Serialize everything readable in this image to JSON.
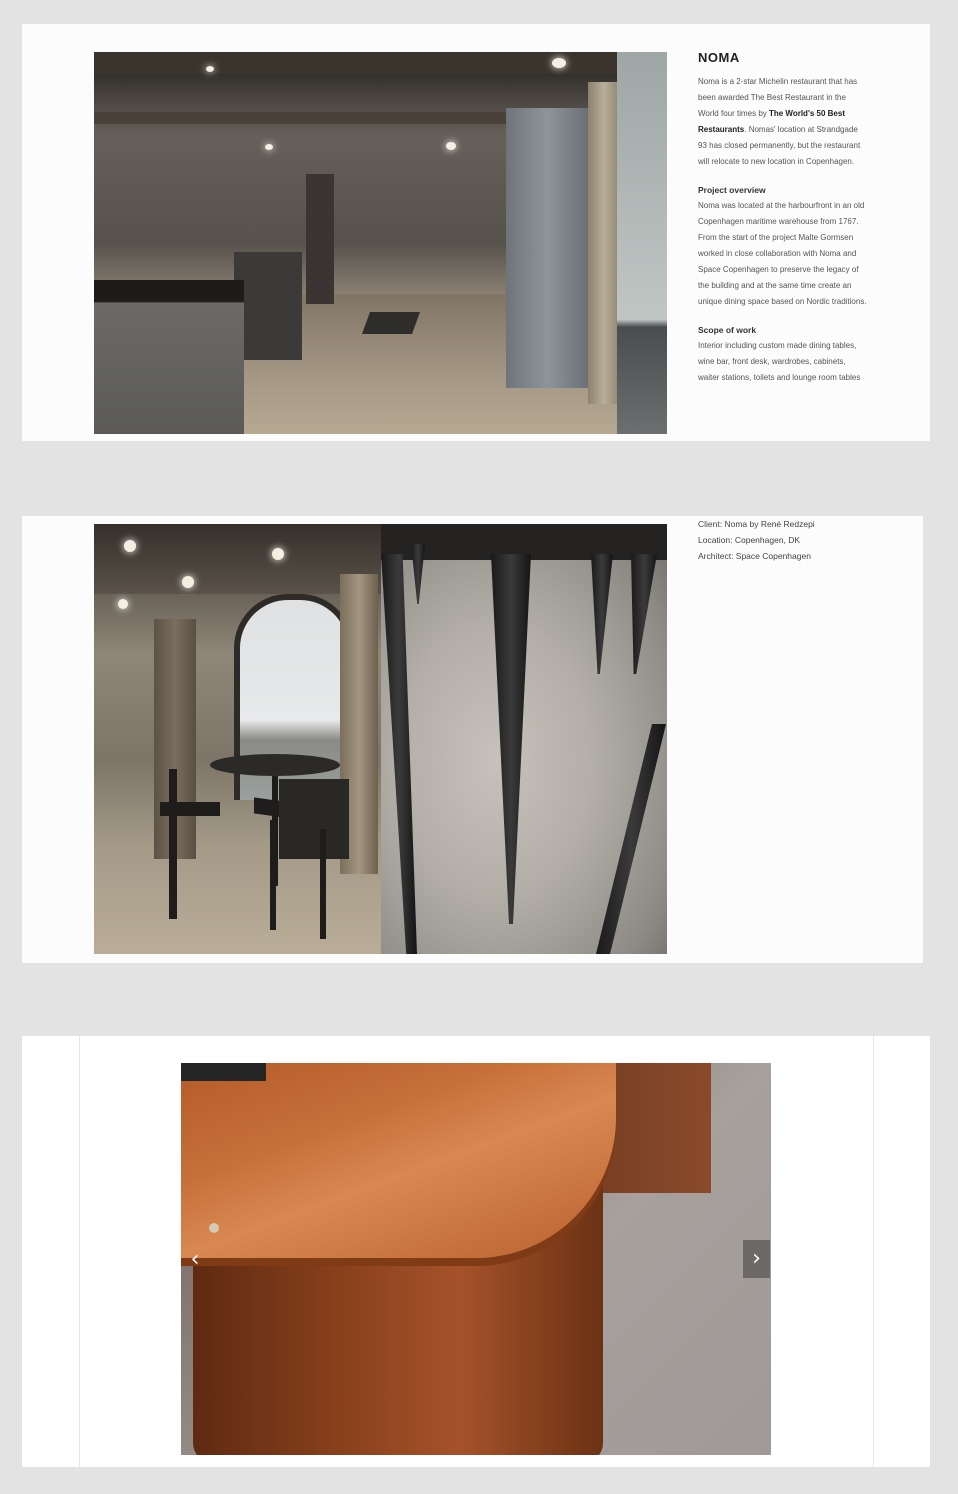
{
  "project": {
    "title": "NOMA",
    "intro_before": "Noma is a 2-star Michelin restaurant that has been awarded The Best Restaurant in the World four times by ",
    "intro_link": "The World's 50 Best Restaurants",
    "intro_after": ". Nomas' location at Strandgade 93 has closed permanently, but the restaurant will relocate to new location in Copenhagen.",
    "overview_label": "Project overview",
    "overview_text": "Noma was located at the harbourfront in an old Copenhagen maritime warehouse from 1767. From the start of the project Malte Gormsen worked in close collaboration with Noma and Space Copenhagen to preserve the legacy of the building and at the same time create an unique dining space based on Nordic traditions.",
    "scope_label": "Scope of work",
    "scope_text": "Interior including custom made dining tables, wine bar, front desk, wardrobes, cabinets, waiter stations, toilets and lounge room tables"
  },
  "details": {
    "client": "Client: Noma by René Redzepi",
    "location": "Location: Copenhagen, DK",
    "architect": "Architect: Space Copenhagen"
  },
  "carousel": {
    "prev_icon": "chevron-left-icon",
    "next_icon": "chevron-right-icon",
    "prev_glyph": "‹",
    "next_glyph": "›"
  }
}
